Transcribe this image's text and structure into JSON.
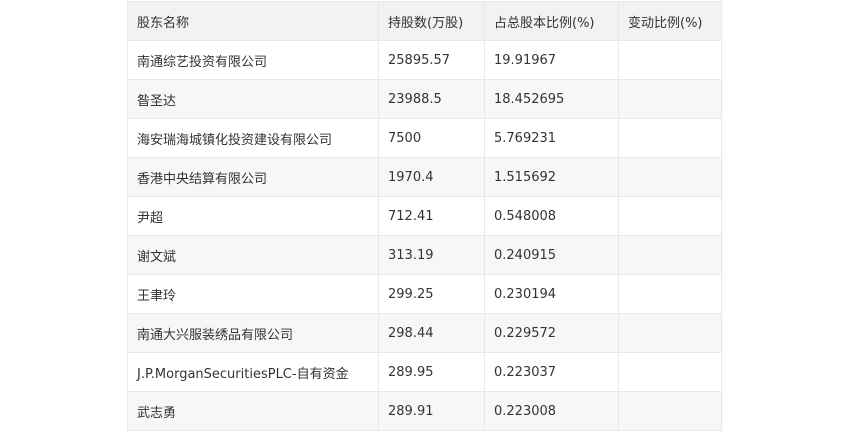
{
  "table": {
    "headers": [
      "股东名称",
      "持股数(万股)",
      "占总股本比例(%)",
      "变动比例(%)"
    ],
    "rows": [
      [
        "南通综艺投资有限公司",
        "25895.57",
        "19.91967",
        ""
      ],
      [
        "昝圣达",
        "23988.5",
        "18.452695",
        ""
      ],
      [
        "海安瑞海城镇化投资建设有限公司",
        "7500",
        "5.769231",
        ""
      ],
      [
        "香港中央结算有限公司",
        "1970.4",
        "1.515692",
        ""
      ],
      [
        "尹超",
        "712.41",
        "0.548008",
        ""
      ],
      [
        "谢文斌",
        "313.19",
        "0.240915",
        ""
      ],
      [
        "王聿玲",
        "299.25",
        "0.230194",
        ""
      ],
      [
        "南通大兴服装绣品有限公司",
        "298.44",
        "0.229572",
        ""
      ],
      [
        "J.P.MorganSecuritiesPLC-自有资金",
        "289.95",
        "0.223037",
        ""
      ],
      [
        "武志勇",
        "289.91",
        "0.223008",
        ""
      ]
    ]
  }
}
